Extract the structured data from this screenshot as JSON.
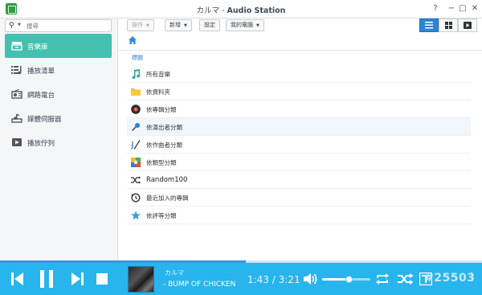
{
  "window": {
    "title_prefix": "カルマ - ",
    "title_app": "Audio Station",
    "help": "?",
    "minimize": "−",
    "maximize": "□",
    "close": "✕"
  },
  "sidebar": {
    "search_placeholder": "搜尋",
    "items": [
      {
        "label": "音樂庫",
        "icon": "library-icon",
        "active": true
      },
      {
        "label": "播放清單",
        "icon": "playlist-icon",
        "active": false
      },
      {
        "label": "網路電台",
        "icon": "radio-icon",
        "active": false
      },
      {
        "label": "媒體伺服器",
        "icon": "media-server-icon",
        "active": false
      },
      {
        "label": "播放佇列",
        "icon": "play-queue-icon",
        "active": false
      }
    ]
  },
  "toolbar": {
    "action_label": "操作",
    "new_label": "新增",
    "settings_label": "設定",
    "mypc_label": "我的電腦"
  },
  "content": {
    "column_header": "標題",
    "rows": [
      {
        "label": "所有音樂",
        "icon": "music-note-icon"
      },
      {
        "label": "依資料夾",
        "icon": "folder-icon"
      },
      {
        "label": "依專輯分類",
        "icon": "album-icon"
      },
      {
        "label": "依演出者分類",
        "icon": "microphone-icon"
      },
      {
        "label": "依作曲者分類",
        "icon": "composer-icon"
      },
      {
        "label": "依類型分類",
        "icon": "genre-icon"
      },
      {
        "label": "Random100",
        "icon": "shuffle-icon"
      },
      {
        "label": "最近加入的專輯",
        "icon": "recent-icon"
      },
      {
        "label": "依評等分類",
        "icon": "star-icon"
      }
    ]
  },
  "player": {
    "track_title": "カルマ",
    "track_artist": "- BUMP OF CHICKEN",
    "time_current": "1:43",
    "time_separator": " / ",
    "time_total": "3:21",
    "progress_fraction": 0.51,
    "volume_fraction": 0.55,
    "watermark": "#25503"
  },
  "colors": {
    "accent": "#43c0b0",
    "player_bg": "#28b4ec",
    "view_active": "#2b86d6"
  }
}
